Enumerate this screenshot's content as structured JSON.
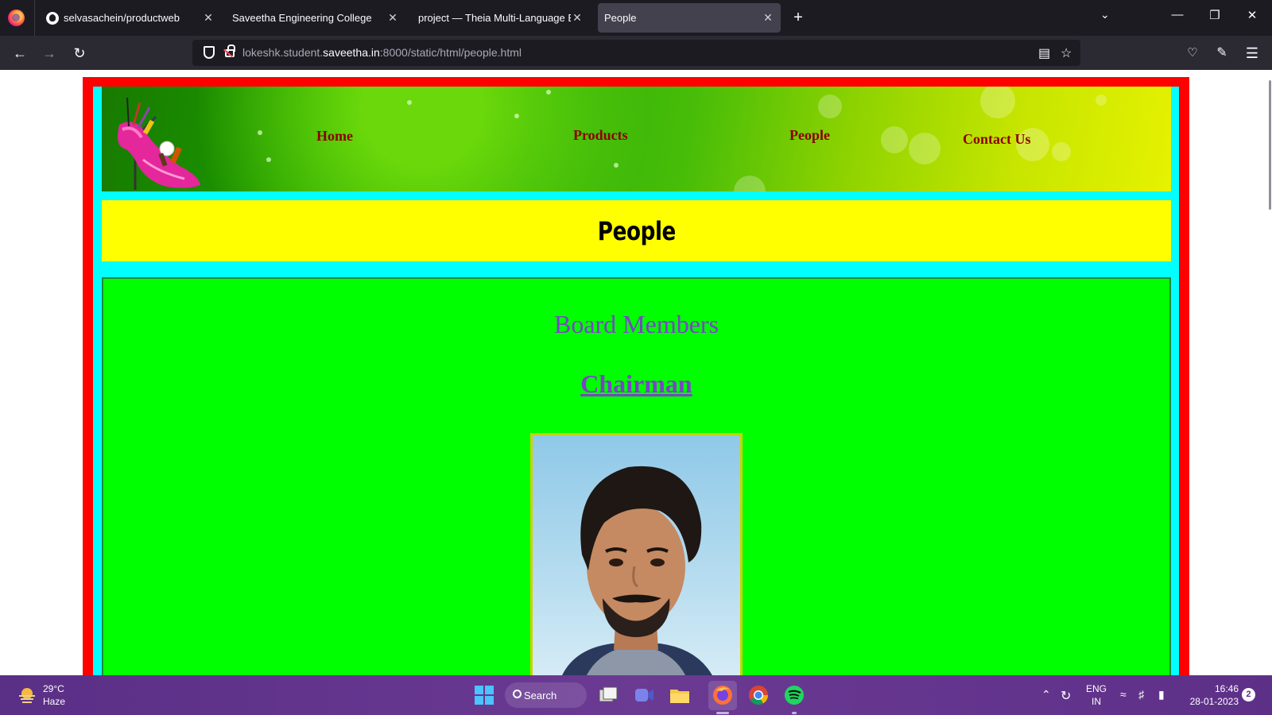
{
  "browser": {
    "tabs": [
      {
        "label": "selvasachein/productweb",
        "active": false
      },
      {
        "label": "Saveetha Engineering College",
        "active": false
      },
      {
        "label": "project — Theia Multi-Language Ex",
        "active": false
      },
      {
        "label": "People",
        "active": true
      }
    ],
    "close_glyph": "✕",
    "new_tab_glyph": "+",
    "url": {
      "prefix": "lokeshk.student.",
      "host": "saveetha.in",
      "suffix": ":8000/static/html/people.html"
    }
  },
  "page": {
    "nav": [
      "Home",
      "Products",
      "People",
      "Contact Us"
    ],
    "heading": "People",
    "board_title": "Board Members",
    "chairman_title": "Chairman"
  },
  "taskbar": {
    "weather": {
      "temp": "29°C",
      "condition": "Haze"
    },
    "search_label": "Search",
    "language": {
      "line1": "ENG",
      "line2": "IN"
    },
    "clock": {
      "time": "16:46",
      "date": "28-01-2023"
    },
    "notifications": "2"
  },
  "colors": {
    "frame_outer": "#ff0000",
    "frame_inner": "#00ffff",
    "heading_bg": "#ffff00",
    "content_bg": "#00ff00",
    "nav_text": "#8b0000",
    "section_text": "#7b43c9"
  },
  "icons": [
    "firefox-icon",
    "github-icon",
    "back-icon",
    "forward-icon",
    "reload-icon",
    "shield-icon",
    "lock-icon",
    "reader-view-icon",
    "bookmark-star-icon",
    "pocket-icon",
    "extensions-icon",
    "menu-icon",
    "windows-start-icon",
    "search-icon",
    "task-view-icon",
    "meet-icon",
    "file-explorer-icon",
    "firefox-taskbar-icon",
    "chrome-icon",
    "spotify-icon",
    "wifi-icon",
    "volume-muted-icon",
    "battery-icon"
  ]
}
